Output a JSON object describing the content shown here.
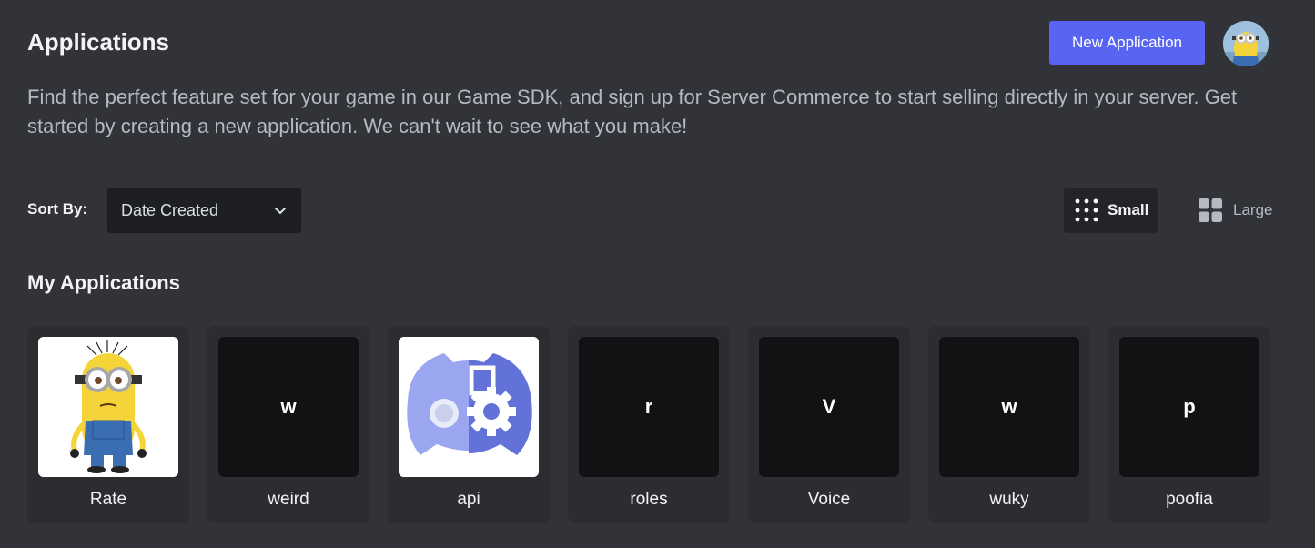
{
  "header": {
    "title": "Applications",
    "new_app_label": "New Application"
  },
  "description": "Find the perfect feature set for your game in our Game SDK, and sign up for Server Commerce to start selling directly in your server. Get started by creating a new application. We can't wait to see what you make!",
  "sort": {
    "label": "Sort By:",
    "value": "Date Created"
  },
  "view_toggle": {
    "small_label": "Small",
    "large_label": "Large",
    "active": "Small"
  },
  "section_title": "My Applications",
  "applications": [
    {
      "name": "Rate",
      "icon": "minion-image"
    },
    {
      "name": "weird",
      "icon": "letter",
      "letter": "w"
    },
    {
      "name": "api",
      "icon": "discord-bot-gear-image"
    },
    {
      "name": "roles",
      "icon": "letter",
      "letter": "r"
    },
    {
      "name": "Voice",
      "icon": "letter",
      "letter": "V"
    },
    {
      "name": "wuky",
      "icon": "letter",
      "letter": "w"
    },
    {
      "name": "poofia",
      "icon": "letter",
      "letter": "p"
    }
  ],
  "colors": {
    "background": "#313338",
    "accent": "#5865f2",
    "card": "#2b2d31"
  }
}
